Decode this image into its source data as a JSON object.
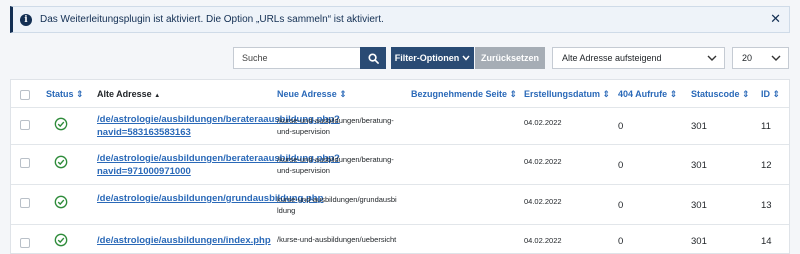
{
  "alert": {
    "message": "Das Weiterleitungsplugin ist aktiviert. Die Option „URLs sammeln“ ist aktiviert.",
    "info_glyph": "i",
    "close_glyph": "✕"
  },
  "toolbar": {
    "search_placeholder": "Suche",
    "filter_label": "Filter-Optionen",
    "reset_label": "Zurücksetzen",
    "sort_value": "Alte Adresse aufsteigend",
    "limit_value": "20"
  },
  "table": {
    "headers": {
      "status": "Status",
      "old_url": "Alte Adresse",
      "new_url": "Neue Adresse",
      "referer": "Bezugnehmende Seite",
      "created": "Erstellungsdatum",
      "hits": "404 Aufrufe",
      "statuscode": "Statuscode",
      "id": "ID"
    },
    "sort_up": "▲",
    "sort_both": "⇕",
    "rows": [
      {
        "old_url": "/de/astrologie/ausbildungen/berateraausbildung.php?navid=583163583163",
        "new_url": "/kurse-und-ausbildungen/beratung-und-supervision",
        "referer": "",
        "created": "04.02.2022",
        "hits": "0",
        "statuscode": "301",
        "id": "11"
      },
      {
        "old_url": "/de/astrologie/ausbildungen/berateraausbildung.php?navid=971000971000",
        "new_url": "/kurse-und-ausbildungen/beratung-und-supervision",
        "referer": "",
        "created": "04.02.2022",
        "hits": "0",
        "statuscode": "301",
        "id": "12"
      },
      {
        "old_url": "/de/astrologie/ausbildungen/grundausbildung.php",
        "new_url": "kurse-und-ausbildungen/grundausbildung",
        "referer": "",
        "created": "04.02.2022",
        "hits": "0",
        "statuscode": "301",
        "id": "13"
      },
      {
        "old_url": "/de/astrologie/ausbildungen/index.php",
        "new_url": "/kurse-und-ausbildungen/uebersicht",
        "referer": "",
        "created": "04.02.2022",
        "hits": "0",
        "statuscode": "301",
        "id": "14"
      }
    ]
  },
  "colors": {
    "primary": "#2a4b74",
    "link": "#2a69b8",
    "success": "#2e8b3a",
    "alert_text": "#132f53"
  },
  "icons": {
    "search": "search-icon",
    "status": "check-circle-icon",
    "chevron": "chevron-down-icon",
    "close": "close-icon",
    "info": "info-icon"
  }
}
